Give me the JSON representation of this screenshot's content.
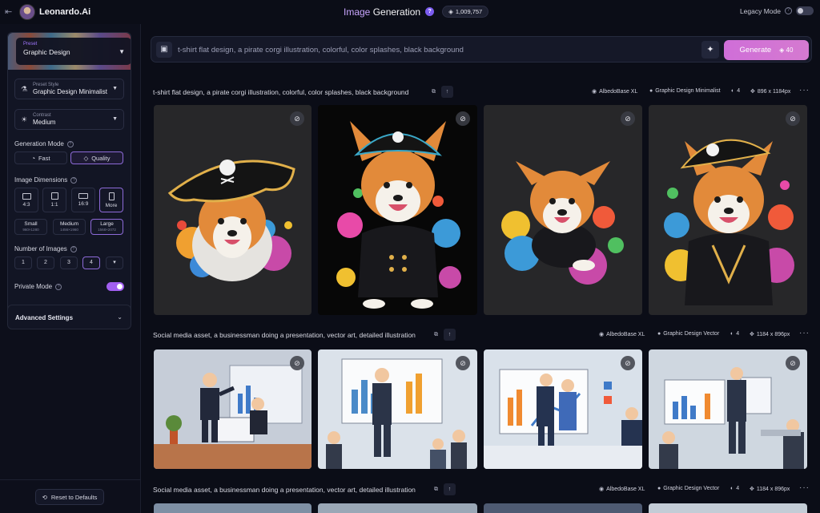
{
  "topbar": {
    "brand": "Leonardo.Ai",
    "title_accent": "Image",
    "title_rest": " Generation",
    "help_glyph": "?",
    "token_count": "1,009,757",
    "legacy_label": "Legacy Mode"
  },
  "sidebar": {
    "preset_label": "Preset",
    "preset_value": "Graphic Design",
    "preset_style_label": "Preset Style",
    "preset_style_value": "Graphic Design Minimalist",
    "contrast_label": "Contrast",
    "contrast_value": "Medium",
    "generation_mode_label": "Generation Mode",
    "mode_fast": "Fast",
    "mode_quality": "Quality",
    "image_dimensions_label": "Image Dimensions",
    "ratios": [
      "4:3",
      "1:1",
      "16:9",
      "More"
    ],
    "sizes": [
      {
        "name": "Small",
        "dims": "960×1280"
      },
      {
        "name": "Medium",
        "dims": "1456×1960"
      },
      {
        "name": "Large",
        "dims": "1568×2072"
      }
    ],
    "number_of_images_label": "Number of Images",
    "numbers": [
      "1",
      "2",
      "3",
      "4"
    ],
    "more_numbers_glyph": "▾",
    "private_mode_label": "Private Mode",
    "advanced_settings_label": "Advanced Settings",
    "reset_label": "Reset to Defaults"
  },
  "prompt_bar": {
    "prompt_text": "t-shirt flat design, a pirate corgi illustration, colorful, color splashes, black background",
    "generate_label": "Generate",
    "generate_cost": "40"
  },
  "groups": [
    {
      "prompt": "t-shirt flat design, a pirate corgi illustration, colorful, color splashes, black background",
      "model": "AlbedoBase XL",
      "style": "Graphic Design Minimalist",
      "count": "4",
      "dims": "896 x 1184px"
    },
    {
      "prompt": "Social media asset, a businessman doing a presentation, vector art, detailed illustration",
      "model": "AlbedoBase XL",
      "style": "Graphic Design Vector",
      "count": "4",
      "dims": "1184 x 896px"
    },
    {
      "prompt": "Social media asset, a businessman doing a presentation, vector art, detailed illustration",
      "model": "AlbedoBase XL",
      "style": "Graphic Design Vector",
      "count": "4",
      "dims": "1184 x 896px"
    }
  ],
  "colors": {
    "accent": "#c9a6ff",
    "generate": "#d26fd6",
    "toggle_on": "#a15ff0",
    "background": "#0b0d17"
  },
  "icons": {
    "back": "back-arrow-icon",
    "token": "token-icon",
    "wand": "magic-wand-icon",
    "hide": "eye-off-icon"
  }
}
